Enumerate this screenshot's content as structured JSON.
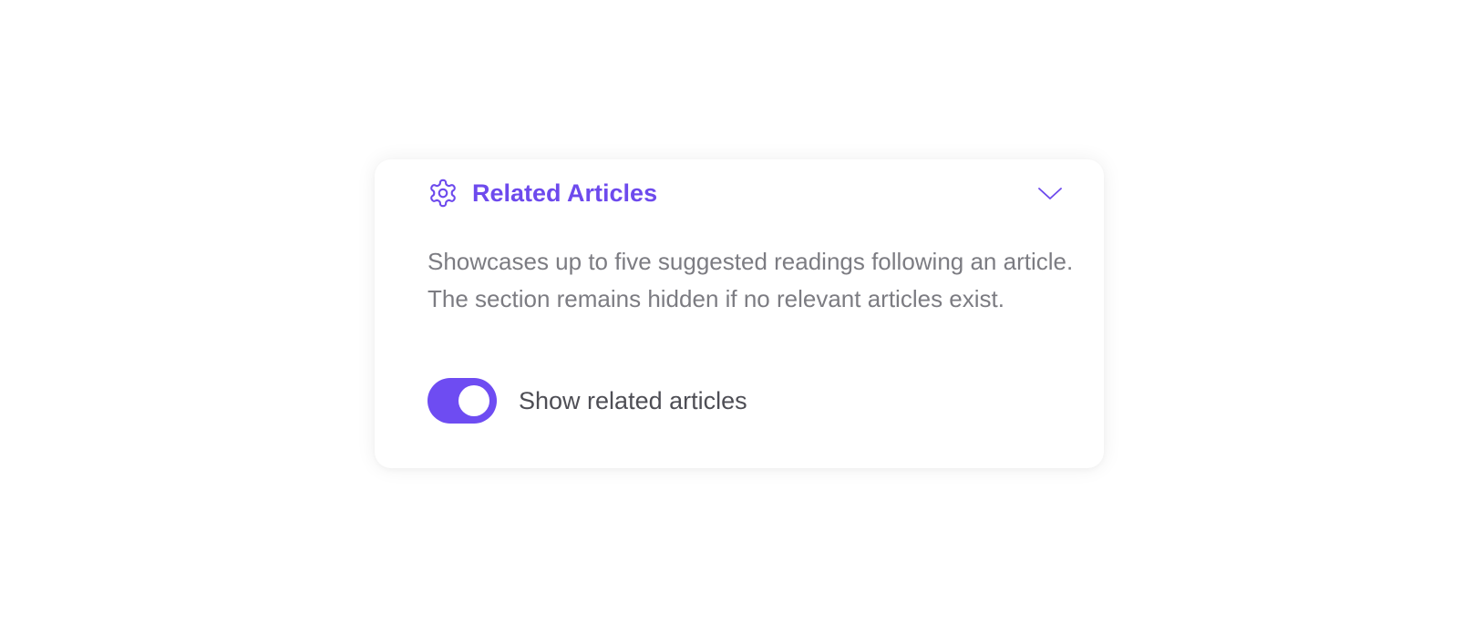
{
  "section": {
    "title": "Related Articles",
    "description": "Showcases up to five suggested readings following an article. The section remains hidden if no relevant articles exist.",
    "expanded": true
  },
  "toggle": {
    "label": "Show related articles",
    "checked": true
  },
  "icons": {
    "header": "gear-icon",
    "collapse": "chevron-down-icon"
  },
  "colors": {
    "accent": "#6d4aed",
    "toggle_on": "#6e4cf2",
    "description_text": "#7c7c82",
    "label_text": "#4e4e55"
  }
}
